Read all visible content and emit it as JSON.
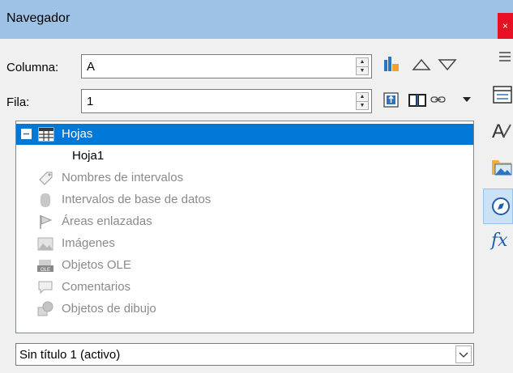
{
  "titlebar": {
    "title": "Navegador",
    "close_glyph": "×"
  },
  "fields": {
    "column_label": "Columna:",
    "column_value": "A",
    "row_label": "Fila:",
    "row_value": "1"
  },
  "toolbar": {
    "icons": [
      "toggle-content-icon",
      "previous-icon",
      "next-icon",
      "drag-mode-icon",
      "promote-icon",
      "link-mode-icon",
      "dropdown-arrow-icon"
    ]
  },
  "tree": {
    "items": [
      {
        "label": "Hojas",
        "selected": true,
        "icon": "sheets-icon",
        "expanded": true
      },
      {
        "label": "Hoja1",
        "child": true
      },
      {
        "label": "Nombres de intervalos",
        "disabled": true,
        "icon": "range-names-icon"
      },
      {
        "label": "Intervalos de base de datos",
        "disabled": true,
        "icon": "database-ranges-icon"
      },
      {
        "label": "Áreas enlazadas",
        "disabled": true,
        "icon": "linked-areas-icon"
      },
      {
        "label": "Imágenes",
        "disabled": true,
        "icon": "images-icon"
      },
      {
        "label": "Objetos OLE",
        "disabled": true,
        "icon": "ole-objects-icon"
      },
      {
        "label": "Comentarios",
        "disabled": true,
        "icon": "comments-icon"
      },
      {
        "label": "Objetos de dibujo",
        "disabled": true,
        "icon": "drawing-objects-icon"
      }
    ]
  },
  "document_select": {
    "value": "Sin título 1 (activo)"
  },
  "sidebar": {
    "icons": [
      "menu-icon",
      "properties-icon",
      "styles-icon",
      "gallery-icon",
      "navigator-icon",
      "functions-icon"
    ],
    "functions_glyph": "fx"
  },
  "colors": {
    "titlebar": "#9dc2e6",
    "selection": "#0078d7",
    "close": "#e81123"
  }
}
